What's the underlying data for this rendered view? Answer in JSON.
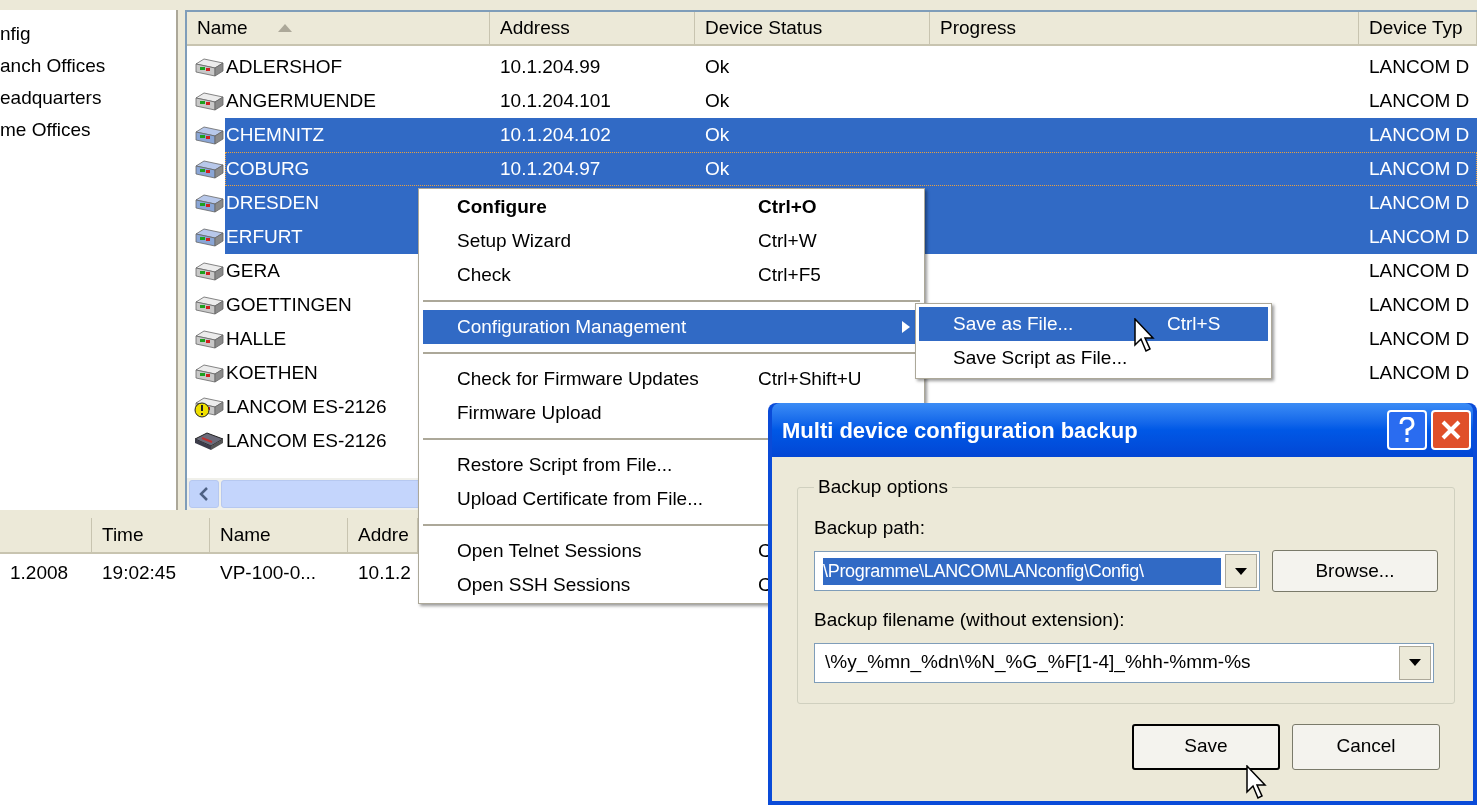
{
  "tree": {
    "items": [
      {
        "label": "nfig"
      },
      {
        "label": "anch Offices"
      },
      {
        "label": "eadquarters"
      },
      {
        "label": "me Offices"
      }
    ]
  },
  "device_list": {
    "columns": [
      {
        "label": "Name",
        "sorted": true
      },
      {
        "label": "Address",
        "sorted": false
      },
      {
        "label": "Device Status",
        "sorted": false
      },
      {
        "label": "Progress",
        "sorted": false
      },
      {
        "label": "Device Typ",
        "sorted": false
      }
    ],
    "rows": [
      {
        "kind": "router",
        "name": "ADLERSHOF",
        "address": "10.1.204.99",
        "status": "Ok",
        "device_type": "LANCOM D",
        "selected": false,
        "focused": false
      },
      {
        "kind": "router",
        "name": "ANGERMUENDE",
        "address": "10.1.204.101",
        "status": "Ok",
        "device_type": "LANCOM D",
        "selected": false,
        "focused": false
      },
      {
        "kind": "router",
        "name": "CHEMNITZ",
        "address": "10.1.204.102",
        "status": "Ok",
        "device_type": "LANCOM D",
        "selected": true,
        "focused": false
      },
      {
        "kind": "router",
        "name": "COBURG",
        "address": "10.1.204.97",
        "status": "Ok",
        "device_type": "LANCOM D",
        "selected": true,
        "focused": true
      },
      {
        "kind": "router",
        "name": "DRESDEN",
        "device_type": "LANCOM D",
        "selected": true,
        "focused": false
      },
      {
        "kind": "router",
        "name": "ERFURT",
        "device_type": "LANCOM D",
        "selected": true,
        "focused": false
      },
      {
        "kind": "router",
        "name": "GERA",
        "device_type": "LANCOM D",
        "selected": false,
        "focused": false
      },
      {
        "kind": "router",
        "name": "GOETTINGEN",
        "device_type": "LANCOM D",
        "selected": false,
        "focused": false
      },
      {
        "kind": "router",
        "name": "HALLE",
        "device_type": "LANCOM D",
        "selected": false,
        "focused": false
      },
      {
        "kind": "router",
        "name": "KOETHEN",
        "device_type": "LANCOM D",
        "selected": false,
        "focused": false
      },
      {
        "kind": "warning",
        "name": "LANCOM ES-2126",
        "selected": false,
        "focused": false
      },
      {
        "kind": "switch",
        "name": "LANCOM ES-2126",
        "selected": false,
        "focused": false
      }
    ]
  },
  "log": {
    "columns": [
      "",
      "Time",
      "Name",
      "Addre"
    ],
    "rows": [
      {
        "cells": [
          "1.2008",
          "19:02:45",
          "VP-100-0...",
          "10.1.2"
        ]
      }
    ]
  },
  "context_menu": {
    "items": [
      {
        "kind": "item",
        "label": "Configure",
        "shortcut": "Ctrl+O",
        "default": true,
        "selected": false,
        "submenu": false
      },
      {
        "kind": "item",
        "label": "Setup Wizard",
        "shortcut": "Ctrl+W",
        "default": false,
        "selected": false,
        "submenu": false
      },
      {
        "kind": "item",
        "label": "Check",
        "shortcut": "Ctrl+F5",
        "default": false,
        "selected": false,
        "submenu": false
      },
      {
        "kind": "separator"
      },
      {
        "kind": "item",
        "label": "Configuration Management",
        "default": false,
        "selected": true,
        "submenu": true
      },
      {
        "kind": "separator"
      },
      {
        "kind": "item",
        "label": "Check for Firmware Updates",
        "shortcut": "Ctrl+Shift+U",
        "default": false,
        "selected": false
      },
      {
        "kind": "item",
        "label": "Firmware Upload",
        "default": false,
        "selected": false
      },
      {
        "kind": "separator"
      },
      {
        "kind": "item",
        "label": "Restore Script from File...",
        "default": false,
        "selected": false
      },
      {
        "kind": "item",
        "label": "Upload Certificate from File...",
        "default": false,
        "selected": false
      },
      {
        "kind": "separator"
      },
      {
        "kind": "item",
        "label": "Open Telnet Sessions",
        "shortcut": "C",
        "default": false,
        "selected": false
      },
      {
        "kind": "item",
        "label": "Open SSH Sessions",
        "shortcut": "C",
        "default": false,
        "selected": false
      }
    ]
  },
  "submenu": {
    "items": [
      {
        "label": "Save as File...",
        "shortcut": "Ctrl+S",
        "selected": true
      },
      {
        "label": "Save Script as File...",
        "selected": false
      }
    ]
  },
  "dialog": {
    "title": "Multi device configuration backup",
    "group_label": "Backup options",
    "path": {
      "label": "Backup path:",
      "value": "\\Programme\\LANCOM\\LANconfig\\Config\\",
      "text_selected": true
    },
    "browse_button": "Browse...",
    "filename": {
      "label": "Backup filename (without extension):",
      "value": "\\%y_%mn_%dn\\%N_%G_%F[1-4]_%hh-%mm-%s"
    },
    "buttons": [
      {
        "label": "Save",
        "default": true
      },
      {
        "label": "Cancel",
        "default": false
      }
    ]
  }
}
